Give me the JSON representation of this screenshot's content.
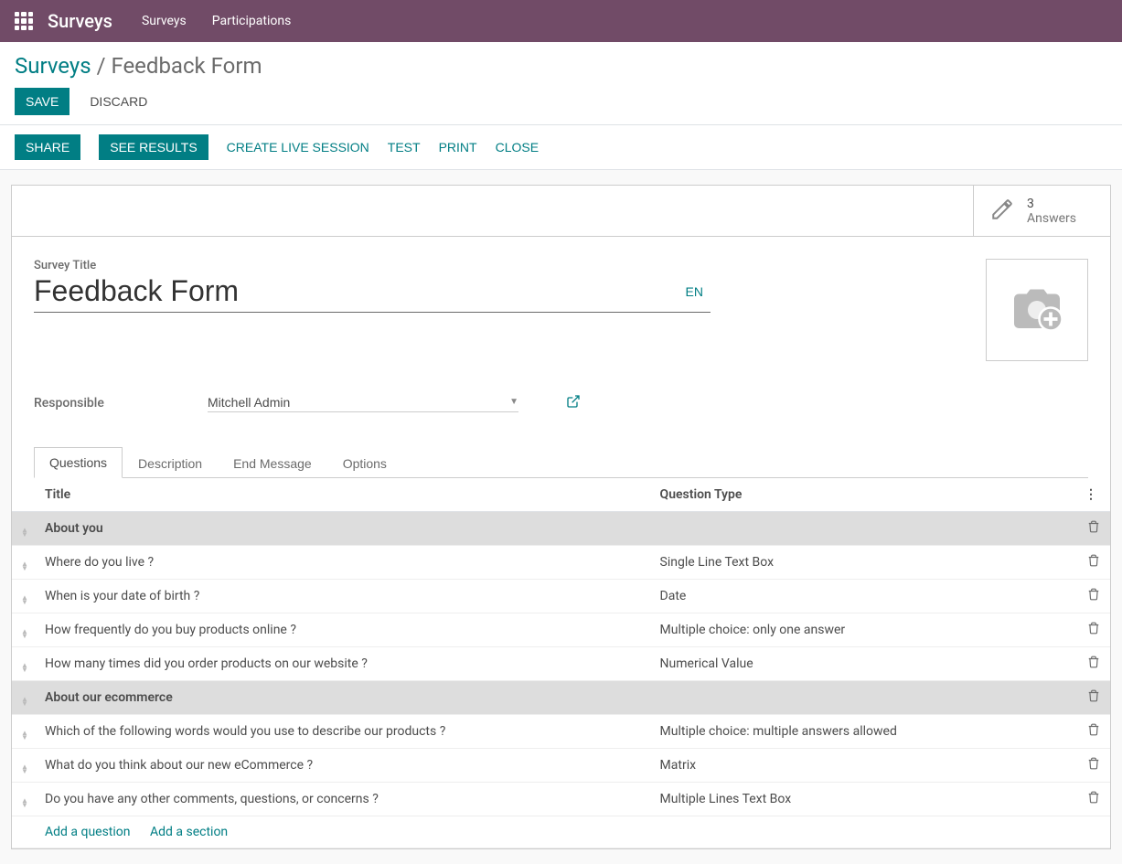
{
  "nav": {
    "app_title": "Surveys",
    "links": [
      "Surveys",
      "Participations"
    ]
  },
  "breadcrumb": {
    "root": "Surveys",
    "sep": " / ",
    "current": "Feedback Form"
  },
  "buttons": {
    "save": "SAVE",
    "discard": "DISCARD",
    "share": "SHARE",
    "see_results": "SEE RESULTS",
    "create_live": "CREATE LIVE SESSION",
    "test": "TEST",
    "print": "PRINT",
    "close": "CLOSE"
  },
  "stat": {
    "count": "3",
    "label": "Answers"
  },
  "title_field": {
    "label": "Survey Title",
    "value": "Feedback Form",
    "lang": "EN"
  },
  "responsible": {
    "label": "Responsible",
    "value": "Mitchell Admin"
  },
  "tabs": [
    "Questions",
    "Description",
    "End Message",
    "Options"
  ],
  "table": {
    "headers": {
      "title": "Title",
      "type": "Question Type"
    },
    "add_question": "Add a question",
    "add_section": "Add a section",
    "rows": [
      {
        "section": true,
        "title": "About you",
        "type": ""
      },
      {
        "section": false,
        "title": "Where do you live ?",
        "type": "Single Line Text Box"
      },
      {
        "section": false,
        "title": "When is your date of birth ?",
        "type": "Date"
      },
      {
        "section": false,
        "title": "How frequently do you buy products online ?",
        "type": "Multiple choice: only one answer"
      },
      {
        "section": false,
        "title": "How many times did you order products on our website ?",
        "type": "Numerical Value"
      },
      {
        "section": true,
        "title": "About our ecommerce",
        "type": ""
      },
      {
        "section": false,
        "title": "Which of the following words would you use to describe our products ?",
        "type": "Multiple choice: multiple answers allowed"
      },
      {
        "section": false,
        "title": "What do you think about our new eCommerce ?",
        "type": "Matrix"
      },
      {
        "section": false,
        "title": "Do you have any other comments, questions, or concerns ?",
        "type": "Multiple Lines Text Box"
      }
    ]
  }
}
